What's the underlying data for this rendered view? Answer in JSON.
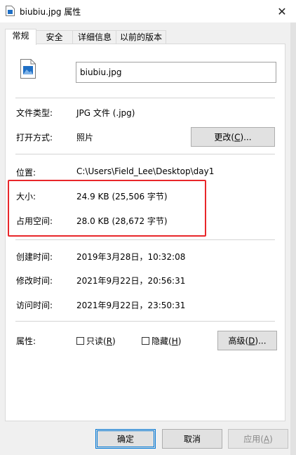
{
  "window": {
    "title": "biubiu.jpg 属性",
    "close_glyph": "✕"
  },
  "tabs": [
    {
      "label": "常规",
      "active": true
    },
    {
      "label": "安全",
      "active": false
    },
    {
      "label": "详细信息",
      "active": false
    },
    {
      "label": "以前的版本",
      "active": false
    }
  ],
  "general": {
    "file_name": "biubiu.jpg",
    "file_type_label": "文件类型:",
    "file_type_value": "JPG 文件 (.jpg)",
    "opens_with_label": "打开方式:",
    "opens_with_value": "照片",
    "change_button": "更改(C)...",
    "change_button_mnemonic": "C",
    "location_label": "位置:",
    "location_value": "C:\\Users\\Field_Lee\\Desktop\\day1",
    "size_label": "大小:",
    "size_value": "24.9 KB (25,506 字节)",
    "size_on_disk_label": "占用空间:",
    "size_on_disk_value": "28.0 KB (28,672 字节)",
    "created_label": "创建时间:",
    "created_value": "2019年3月28日，10:32:08",
    "modified_label": "修改时间:",
    "modified_value": "2021年9月22日，20:56:31",
    "accessed_label": "访问时间:",
    "accessed_value": "2021年9月22日，23:50:31",
    "attributes_label": "属性:",
    "readonly_pre": "只读(",
    "readonly_key": "R",
    "readonly_post": ")",
    "readonly_checked": false,
    "hidden_pre": "隐藏(",
    "hidden_key": "H",
    "hidden_post": ")",
    "hidden_checked": false,
    "advanced_pre": "高级(",
    "advanced_key": "D",
    "advanced_post": ")..."
  },
  "footer": {
    "ok": "确定",
    "cancel": "取消",
    "apply_pre": "应用(",
    "apply_key": "A",
    "apply_post": ")",
    "apply_enabled": false
  },
  "annotation": {
    "highlight_color": "#e8262a"
  },
  "colors": {
    "focus_blue": "#0078d7",
    "icon_blue": "#1f6fc5"
  }
}
